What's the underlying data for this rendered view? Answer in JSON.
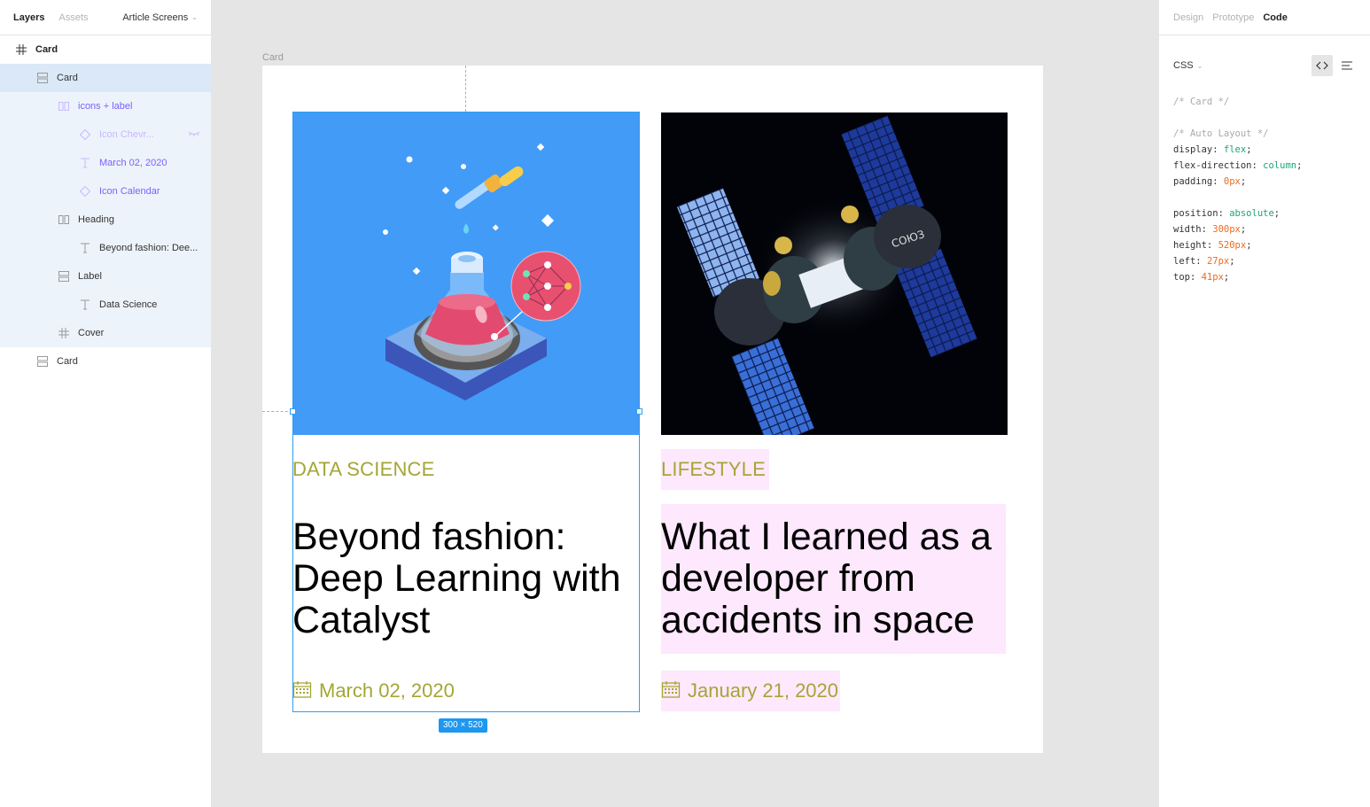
{
  "left_panel": {
    "tabs": [
      {
        "label": "Layers",
        "active": true
      },
      {
        "label": "Assets",
        "active": false
      }
    ],
    "page_selector": "Article Screens",
    "layers": [
      {
        "label": "Card",
        "icon": "frame-icon",
        "indent": 0,
        "state": "bold"
      },
      {
        "label": "Card",
        "icon": "autolayout-vertical-icon",
        "indent": 1,
        "state": "selected"
      },
      {
        "label": "icons + label",
        "icon": "autolayout-horizontal-icon",
        "indent": 2,
        "state": "purple"
      },
      {
        "label": "Icon Chevr...",
        "icon": "component-instance-icon",
        "indent": 3,
        "state": "faded",
        "hidden": true
      },
      {
        "label": "March 02, 2020",
        "icon": "text-icon",
        "indent": 3,
        "state": "purple"
      },
      {
        "label": "Icon Calendar",
        "icon": "component-instance-icon",
        "indent": 3,
        "state": "purple"
      },
      {
        "label": "Heading",
        "icon": "autolayout-horizontal-icon",
        "indent": 2,
        "state": "child"
      },
      {
        "label": "Beyond fashion: Dee...",
        "icon": "text-icon",
        "indent": 3,
        "state": "child"
      },
      {
        "label": "Label",
        "icon": "autolayout-vertical-icon",
        "indent": 2,
        "state": "child"
      },
      {
        "label": "Data Science",
        "icon": "text-icon",
        "indent": 3,
        "state": "child"
      },
      {
        "label": "Cover",
        "icon": "frame-icon",
        "indent": 2,
        "state": "child"
      },
      {
        "label": "Card",
        "icon": "autolayout-vertical-icon",
        "indent": 1,
        "state": "normal"
      }
    ]
  },
  "right_panel": {
    "tabs": [
      {
        "label": "Design",
        "active": false
      },
      {
        "label": "Prototype",
        "active": false
      },
      {
        "label": "Code",
        "active": true
      }
    ],
    "language": "CSS",
    "code_lines": [
      [
        {
          "t": "/* Card */",
          "c": "cm"
        }
      ],
      [],
      [
        {
          "t": "/* Auto Layout */",
          "c": "cm"
        }
      ],
      [
        {
          "t": "display: ",
          "c": ""
        },
        {
          "t": "flex",
          "c": "kw"
        },
        {
          "t": ";",
          "c": ""
        }
      ],
      [
        {
          "t": "flex-direction: ",
          "c": ""
        },
        {
          "t": "column",
          "c": "kw"
        },
        {
          "t": ";",
          "c": ""
        }
      ],
      [
        {
          "t": "padding: ",
          "c": ""
        },
        {
          "t": "0px",
          "c": "num"
        },
        {
          "t": ";",
          "c": ""
        }
      ],
      [],
      [
        {
          "t": "position: ",
          "c": ""
        },
        {
          "t": "absolute",
          "c": "kw"
        },
        {
          "t": ";",
          "c": ""
        }
      ],
      [
        {
          "t": "width: ",
          "c": ""
        },
        {
          "t": "300px",
          "c": "num"
        },
        {
          "t": ";",
          "c": ""
        }
      ],
      [
        {
          "t": "height: ",
          "c": ""
        },
        {
          "t": "520px",
          "c": "num"
        },
        {
          "t": ";",
          "c": ""
        }
      ],
      [
        {
          "t": "left: ",
          "c": ""
        },
        {
          "t": "27px",
          "c": "num"
        },
        {
          "t": ";",
          "c": ""
        }
      ],
      [
        {
          "t": "top: ",
          "c": ""
        },
        {
          "t": "41px",
          "c": "num"
        },
        {
          "t": ";",
          "c": ""
        }
      ]
    ]
  },
  "canvas": {
    "frame_label": "Card",
    "size_badge": "300 × 520",
    "cards": [
      {
        "label": "DATA SCIENCE",
        "heading": "Beyond fashion: Deep Learning with Catalyst",
        "date": "March 02, 2020",
        "cover": "chemistry-flask-illustration"
      },
      {
        "label": "LIFESTYLE",
        "heading": "What I learned as a developer from accidents in space",
        "date": "January 21, 2020",
        "cover": "satellite-soyuz-illustration"
      }
    ]
  },
  "colors": {
    "accent": "#a4a636",
    "selection": "#2e9ff0",
    "highlight": "#fde8fd",
    "cover_blue": "#429bf7"
  }
}
